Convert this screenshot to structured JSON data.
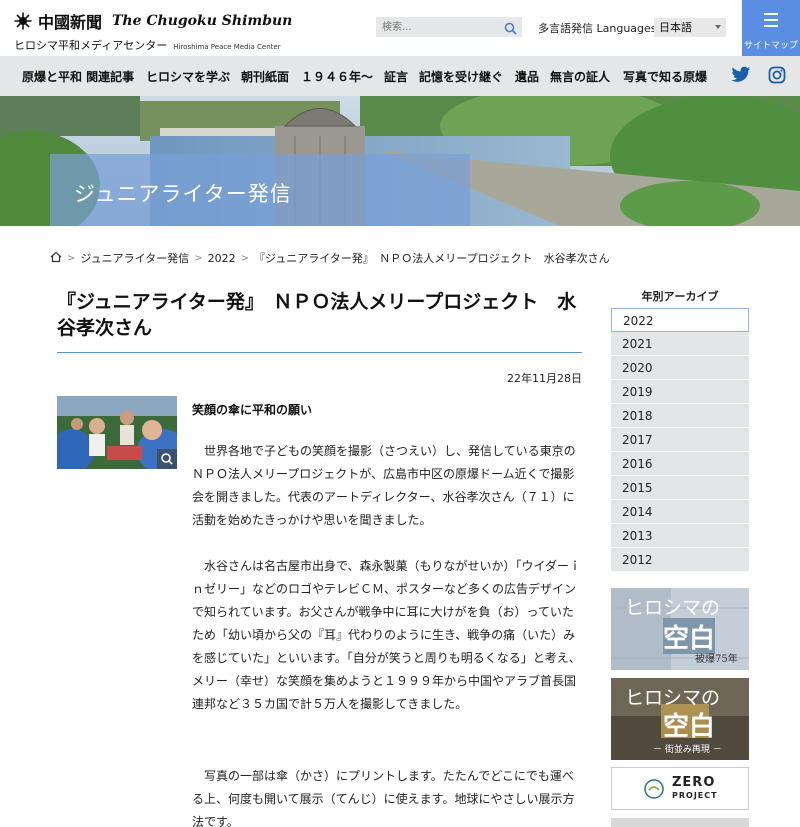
{
  "header": {
    "logo_jp": "中國新聞",
    "logo_en": "The Chugoku Shimbun",
    "logo_sub_jp": "ヒロシマ平和メディアセンター",
    "logo_sub_en": "Hiroshima Peace Media Center",
    "search_placeholder": "検索...",
    "lang_label": "多言語発信 Languages",
    "lang_value": "日本語",
    "sitemap_label": "サイトマップ"
  },
  "nav": {
    "items": [
      "原爆と平和 関連記事",
      "ヒロシマを学ぶ",
      "朝刊紙面",
      "１９４６年～",
      "証言",
      "記憶を受け継ぐ",
      "遺品",
      "無言の証人",
      "写真で知る原爆"
    ]
  },
  "hero": {
    "title": "ジュニアライター発信"
  },
  "breadcrumb": [
    "ジュニアライター発信",
    "2022",
    "『ジュニアライター発』　ＮＰＯ法人メリープロジェクト　水谷孝次さん"
  ],
  "article": {
    "title": "『ジュニアライター発』　ＮＰＯ法人メリープロジェクト　水谷孝次さん",
    "date": "22年11月28日",
    "headline": "笑顔の傘に平和の願い",
    "paragraphs": [
      "　世界各地で子どもの笑顔を撮影（さつえい）し、発信している東京のＮＰＯ法人メリープロジェクトが、広島市中区の原爆ドーム近くで撮影会を開きました。代表のアートディレクター、水谷孝次さん（７１）に活動を始めたきっかけや思いを聞きました。",
      "　水谷さんは名古屋市出身で、森永製菓（もりながせいか）「ウイダーｉｎゼリー」などのロゴやテレビＣＭ、ポスターなど多くの広告デザインで知られています。お父さんが戦争中に耳に大けがを負（お）っていたため「幼い頃から父の『耳』代わりのように生き、戦争の痛（いた）みを感じていた」といいます。「自分が笑うと周りも明るくなる」と考え、メリー（幸せ）な笑顔を集めようと１９９９年から中国やアラブ首長国連邦など３５カ国で計５万人を撮影してきました。",
      "　写真の一部は傘（かさ）にプリントします。たたんでどこにでも運べる上、何度も開いて展示（てんじ）に使えます。地球にやさしい展示方法です。"
    ]
  },
  "sidebar": {
    "archive_heading": "年別アーカイブ",
    "years": [
      "2022",
      "2021",
      "2020",
      "2019",
      "2018",
      "2017",
      "2016",
      "2015",
      "2014",
      "2013",
      "2012"
    ],
    "banner1": {
      "title1": "ヒロシマの",
      "title2": "空白",
      "sub": "被爆75年"
    },
    "banner2": {
      "title1": "ヒロシマの",
      "title2": "空白",
      "sub": "－ 街並み再現 －"
    },
    "banner3": {
      "line1": "ZERO",
      "line2": "PROJECT"
    }
  },
  "colors": {
    "accent": "#5a8ee0",
    "nav_bg": "#e5e6e7",
    "archive_bg": "#e4e5e6"
  }
}
